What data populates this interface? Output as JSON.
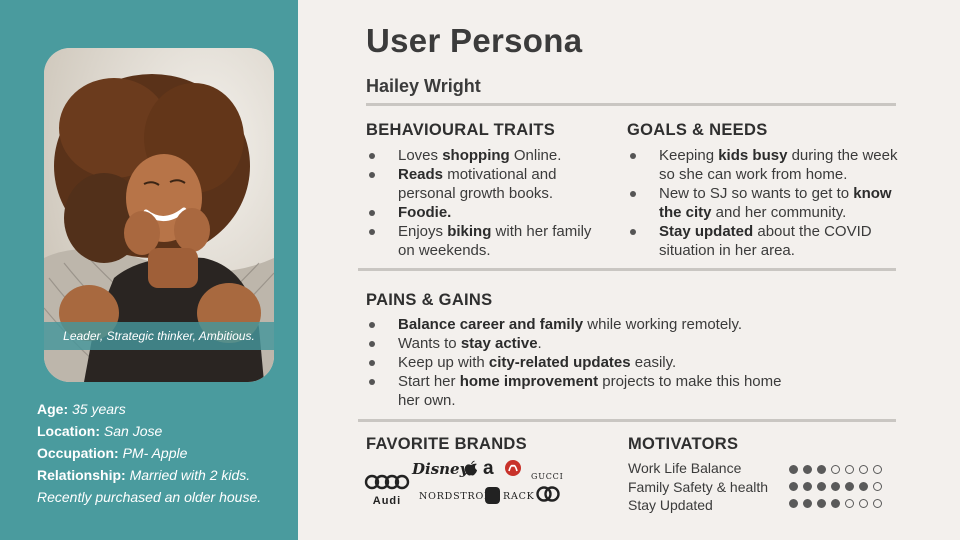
{
  "title": "User Persona",
  "name": "Hailey Wright",
  "tagline": "Leader, Strategic thinker, Ambitious.",
  "facts": [
    {
      "label": "Age:",
      "value": "35 years"
    },
    {
      "label": "Location:",
      "value": "San Jose"
    },
    {
      "label": "Occupation:",
      "value": "PM- Apple"
    },
    {
      "label": "Relationship:",
      "value": "Married with 2 kids."
    }
  ],
  "facts_note": "Recently purchased an older house.",
  "behavioural": {
    "heading": "BEHAVIOURAL TRAITS",
    "items": [
      [
        {
          "t": "Loves "
        },
        {
          "t": "shopping",
          "b": true
        },
        {
          "t": " Online."
        }
      ],
      [
        {
          "t": "Reads",
          "b": true
        },
        {
          "t": " motivational and personal growth books."
        }
      ],
      [
        {
          "t": "Foodie.",
          "b": true
        }
      ],
      [
        {
          "t": "Enjoys "
        },
        {
          "t": "biking",
          "b": true
        },
        {
          "t": " with her family on weekends."
        }
      ]
    ]
  },
  "goals": {
    "heading": "GOALS & NEEDS",
    "items": [
      [
        {
          "t": "Keeping "
        },
        {
          "t": "kids busy",
          "b": true
        },
        {
          "t": " during the week so she can work from home."
        }
      ],
      [
        {
          "t": "New to SJ so wants to get to "
        },
        {
          "t": "know the city",
          "b": true
        },
        {
          "t": " and her community."
        }
      ],
      [
        {
          "t": "Stay updated",
          "b": true
        },
        {
          "t": " about the COVID situation in her area."
        }
      ]
    ]
  },
  "pains": {
    "heading": "PAINS & GAINS",
    "items": [
      [
        {
          "t": "Balance career and family",
          "b": true
        },
        {
          "t": " while working remotely."
        }
      ],
      [
        {
          "t": "Wants to "
        },
        {
          "t": "stay active",
          "b": true
        },
        {
          "t": "."
        }
      ],
      [
        {
          "t": "Keep up with "
        },
        {
          "t": "city-related updates",
          "b": true
        },
        {
          "t": " easily."
        }
      ],
      [
        {
          "t": "Start her "
        },
        {
          "t": "home improvement",
          "b": true
        },
        {
          "t": " projects to make this home her own."
        }
      ]
    ]
  },
  "brands": {
    "heading": "FAVORITE BRANDS",
    "audi": "Audi",
    "disney": "Disney",
    "gucci": "GUCCI",
    "nordstrom": "NORDSTROM",
    "rack": "RACK"
  },
  "motivators": {
    "heading": "MOTIVATORS",
    "items": [
      {
        "label": "Work Life Balance",
        "level": 3,
        "max": 7
      },
      {
        "label": "Family Safety & health",
        "level": 6,
        "max": 7
      },
      {
        "label": "Stay Updated",
        "level": 4,
        "max": 7
      }
    ]
  }
}
